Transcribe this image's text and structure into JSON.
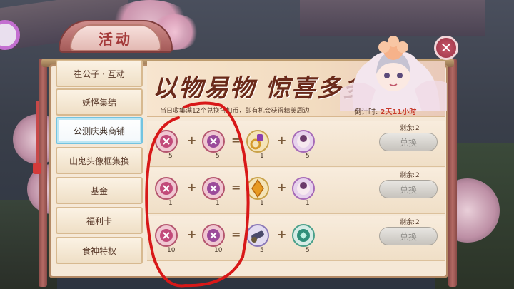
{
  "window": {
    "title": "活动",
    "close_glyph": "✕"
  },
  "sidebar": {
    "items": [
      {
        "label": "崔公子 · 互动",
        "active": false
      },
      {
        "label": "妖怪集结",
        "active": false
      },
      {
        "label": "公测庆典商铺",
        "active": true
      },
      {
        "label": "山鬼头像框集换",
        "active": false
      },
      {
        "label": "基金",
        "active": false
      },
      {
        "label": "福利卡",
        "active": false
      },
      {
        "label": "食神特权",
        "active": false
      }
    ]
  },
  "banner": {
    "title": "以物易物 惊喜多多!",
    "subtitle": "当日收集满12个兑换扭扣币，即有机会获得精美周边",
    "countdown_label": "倒计时:",
    "countdown_value": "2天11小时"
  },
  "exchange": {
    "button_label": "兑换",
    "remain_label": "剩余:",
    "rows": [
      {
        "remain": "2",
        "inputs": [
          {
            "icon": "pink-coin-icon",
            "qty": "5"
          },
          {
            "icon": "pink-coin-icon",
            "qty": "5"
          }
        ],
        "outputs": [
          {
            "icon": "ring-icon",
            "qty": "1"
          },
          {
            "icon": "avatar-token-icon",
            "qty": "5"
          }
        ]
      },
      {
        "remain": "2",
        "inputs": [
          {
            "icon": "pink-coin-icon",
            "qty": "1"
          },
          {
            "icon": "pink-coin-icon",
            "qty": "1"
          }
        ],
        "outputs": [
          {
            "icon": "amber-gem-icon",
            "qty": "1"
          },
          {
            "icon": "avatar-token-icon",
            "qty": "1"
          }
        ]
      },
      {
        "remain": "2",
        "inputs": [
          {
            "icon": "pink-coin-icon",
            "qty": "10"
          },
          {
            "icon": "pink-coin-icon",
            "qty": "10"
          }
        ],
        "outputs": [
          {
            "icon": "cannon-icon",
            "qty": "5"
          },
          {
            "icon": "jade-token-icon",
            "qty": "5"
          }
        ]
      }
    ]
  },
  "colors": {
    "accent_red": "#c73a2a",
    "active_tab_border": "#73c3e0",
    "annotation_red": "#d81818"
  }
}
